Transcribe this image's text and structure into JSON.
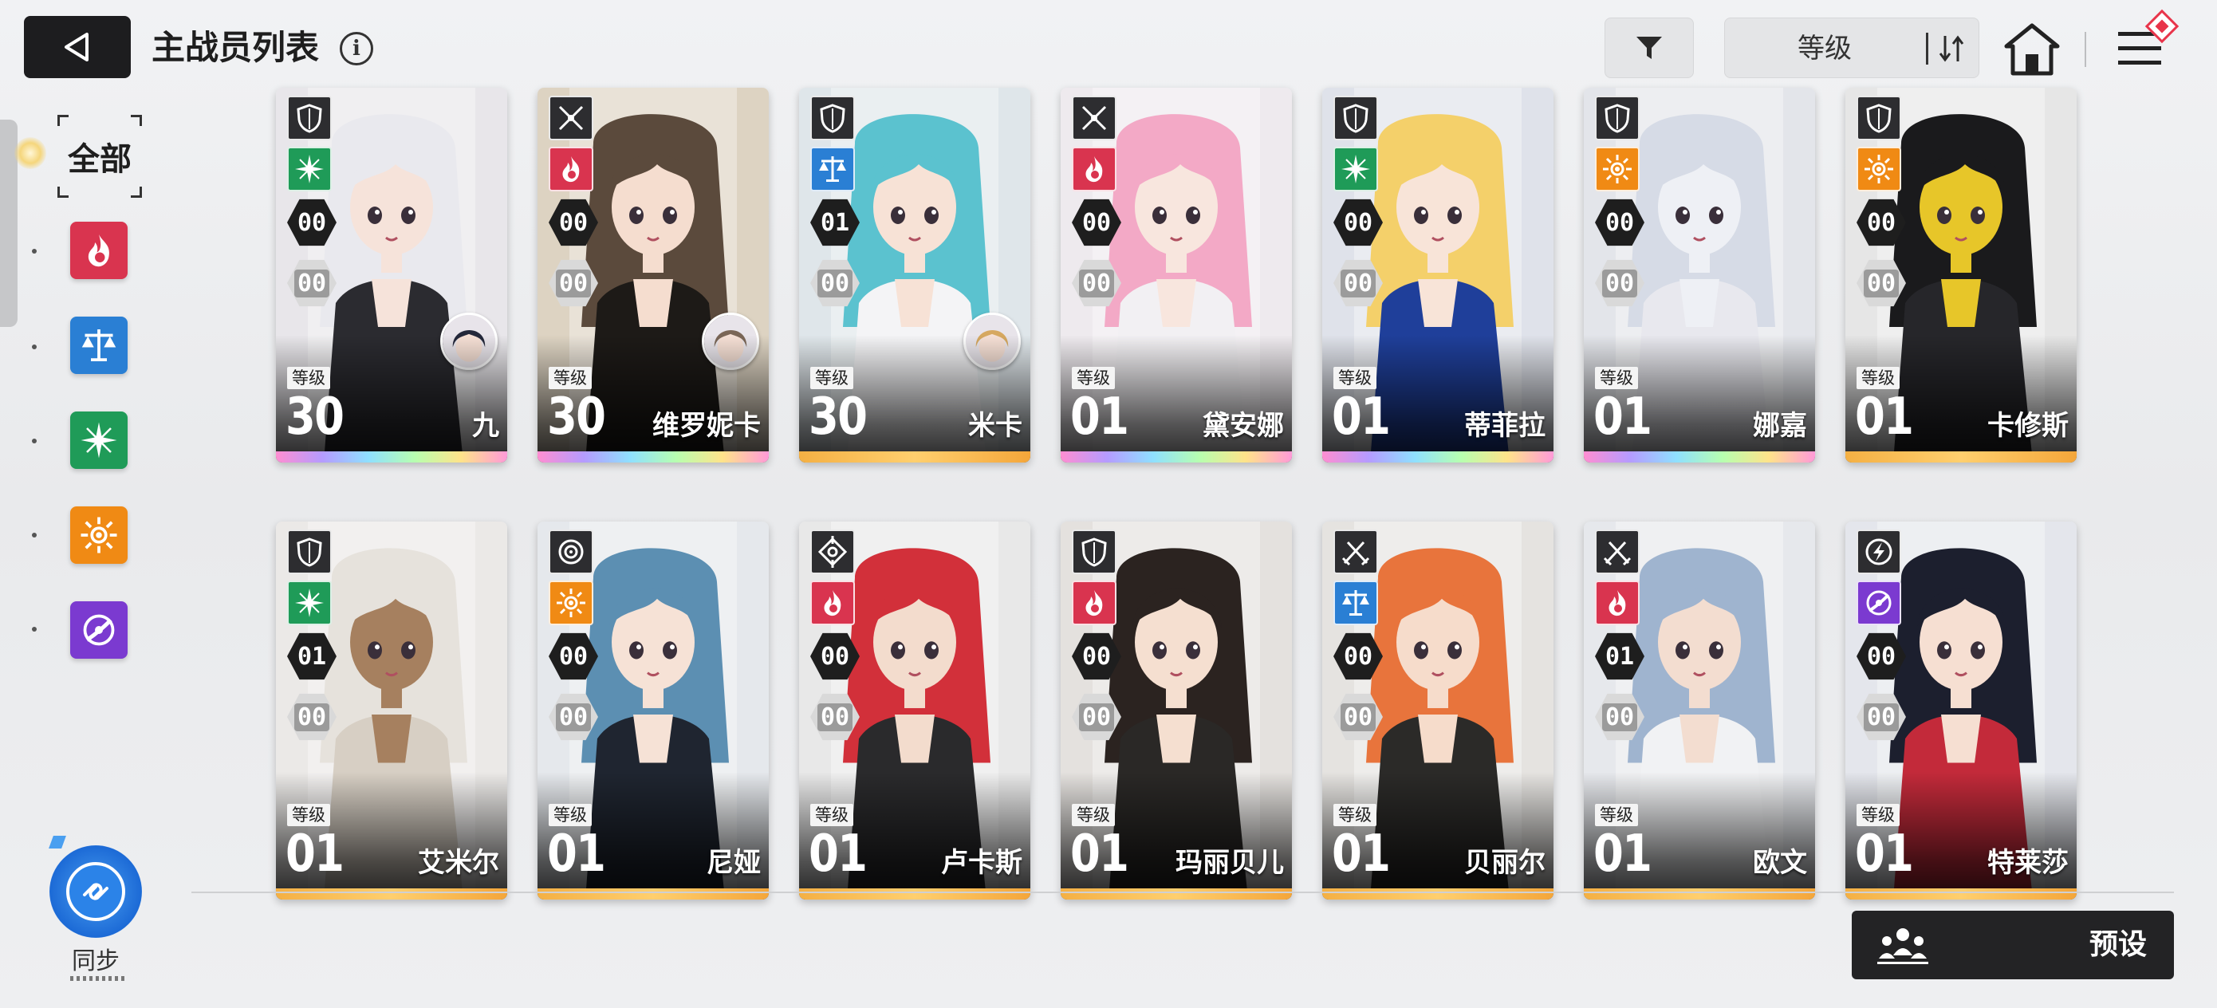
{
  "header": {
    "title": "主战员列表",
    "info_label": "i",
    "sort": {
      "label": "等级"
    }
  },
  "sidebar": {
    "all_label": "全部",
    "filters": [
      {
        "name": "fire",
        "color": "#d9344f"
      },
      {
        "name": "balance",
        "color": "#2a7fd4"
      },
      {
        "name": "wind",
        "color": "#1f9b58"
      },
      {
        "name": "solar",
        "color": "#f08a14"
      },
      {
        "name": "void",
        "color": "#7b3ad0"
      }
    ],
    "sync_label": "同步"
  },
  "level_tag": "等级",
  "cards": [
    {
      "name": "九",
      "level": "30",
      "stat1": "00",
      "stat2": "00",
      "class_icon": "shield-icon",
      "element": "wind",
      "element_color": "#1f9b58",
      "rarity": "rainbow",
      "hair": "#e9e9ee",
      "outfit": "#2b2b30",
      "skin": "#f6e3da",
      "bg": "#e8e6ea",
      "has_avatar": true,
      "avatar_hair": "#24283a"
    },
    {
      "name": "维罗妮卡",
      "level": "30",
      "stat1": "00",
      "stat2": "00",
      "class_icon": "sword-icon",
      "element": "fire",
      "element_color": "#d9344f",
      "rarity": "rainbow",
      "hair": "#5b4a3c",
      "outfit": "#1d1a17",
      "skin": "#f5ddcf",
      "bg": "#ddd3c2",
      "has_avatar": true,
      "avatar_hair": "#7a6656"
    },
    {
      "name": "米卡",
      "level": "30",
      "stat1": "01",
      "stat2": "00",
      "class_icon": "shield-icon",
      "element": "balance",
      "element_color": "#2a7fd4",
      "rarity": "gold",
      "hair": "#5bc2cf",
      "outfit": "#f4f4f6",
      "skin": "#f7e2d6",
      "bg": "#dfe6ea",
      "has_avatar": true,
      "avatar_hair": "#d6a860"
    },
    {
      "name": "黛安娜",
      "level": "01",
      "stat1": "00",
      "stat2": "00",
      "class_icon": "sword-icon",
      "element": "fire",
      "element_color": "#d9344f",
      "rarity": "rainbow",
      "hair": "#f3a9c6",
      "outfit": "#f2f0f3",
      "skin": "#f8e6de",
      "bg": "#eeeaee",
      "has_avatar": false,
      "avatar_hair": ""
    },
    {
      "name": "蒂菲拉",
      "level": "01",
      "stat1": "00",
      "stat2": "00",
      "class_icon": "shield-icon",
      "element": "wind",
      "element_color": "#1f9b58",
      "rarity": "rainbow",
      "hair": "#f4d06a",
      "outfit": "#1f3f9a",
      "skin": "#f8e4d8",
      "bg": "#dfe2ea",
      "has_avatar": false,
      "avatar_hair": ""
    },
    {
      "name": "娜嘉",
      "level": "01",
      "stat1": "00",
      "stat2": "00",
      "class_icon": "shield-icon",
      "element": "solar",
      "element_color": "#f08a14",
      "rarity": "rainbow",
      "hair": "#d6dbe6",
      "outfit": "#e8e8ee",
      "skin": "#eef0f5",
      "bg": "#e3e5ea",
      "has_avatar": false,
      "avatar_hair": ""
    },
    {
      "name": "卡修斯",
      "level": "01",
      "stat1": "00",
      "stat2": "00",
      "class_icon": "shield-icon",
      "element": "solar",
      "element_color": "#f08a14",
      "rarity": "gold",
      "hair": "#1a1a1c",
      "outfit": "#26262a",
      "skin": "#e7c629",
      "bg": "#e6e6e6",
      "has_avatar": false,
      "avatar_hair": ""
    },
    {
      "name": "艾米尔",
      "level": "01",
      "stat1": "01",
      "stat2": "00",
      "class_icon": "shield-icon",
      "element": "wind",
      "element_color": "#1f9b58",
      "rarity": "gold",
      "hair": "#e6e2dc",
      "outfit": "#d7cfc4",
      "skin": "#a6805f",
      "bg": "#ebe9e7",
      "has_avatar": false,
      "avatar_hair": ""
    },
    {
      "name": "尼娅",
      "level": "01",
      "stat1": "00",
      "stat2": "00",
      "class_icon": "target-icon",
      "element": "solar",
      "element_color": "#f08a14",
      "rarity": "gold",
      "hair": "#5c8fb2",
      "outfit": "#1f2530",
      "skin": "#f6e2d6",
      "bg": "#e5e8ec",
      "has_avatar": false,
      "avatar_hair": ""
    },
    {
      "name": "卢卡斯",
      "level": "01",
      "stat1": "00",
      "stat2": "00",
      "class_icon": "crosshair-icon",
      "element": "fire",
      "element_color": "#d9344f",
      "rarity": "gold",
      "hair": "#d2303a",
      "outfit": "#2a2a2c",
      "skin": "#f3dccd",
      "bg": "#e8e8e8",
      "has_avatar": false,
      "avatar_hair": ""
    },
    {
      "name": "玛丽贝儿",
      "level": "01",
      "stat1": "00",
      "stat2": "00",
      "class_icon": "shield-icon",
      "element": "fire",
      "element_color": "#d9344f",
      "rarity": "gold",
      "hair": "#2b2320",
      "outfit": "#2a2826",
      "skin": "#f5dfd0",
      "bg": "#e4e1de",
      "has_avatar": false,
      "avatar_hair": ""
    },
    {
      "name": "贝丽尔",
      "level": "01",
      "stat1": "00",
      "stat2": "00",
      "class_icon": "dual-sword-icon",
      "element": "balance",
      "element_color": "#2a7fd4",
      "rarity": "gold",
      "hair": "#e8743c",
      "outfit": "#2b2a28",
      "skin": "#f6dccb",
      "bg": "#e5e3e0",
      "has_avatar": false,
      "avatar_hair": ""
    },
    {
      "name": "欧文",
      "level": "01",
      "stat1": "01",
      "stat2": "00",
      "class_icon": "dual-sword-icon",
      "element": "fire",
      "element_color": "#d9344f",
      "rarity": "gold",
      "hair": "#9fb4cf",
      "outfit": "#f1f2f4",
      "skin": "#f3ddd0",
      "bg": "#e6e8ec",
      "has_avatar": false,
      "avatar_hair": ""
    },
    {
      "name": "特莱莎",
      "level": "01",
      "stat1": "00",
      "stat2": "00",
      "class_icon": "lightning-icon",
      "element": "void",
      "element_color": "#7b3ad0",
      "rarity": "gold",
      "hair": "#1c1f2e",
      "outfit": "#c32a3a",
      "skin": "#f6dfd2",
      "bg": "#e4e6ec",
      "has_avatar": false,
      "avatar_hair": ""
    }
  ],
  "footer": {
    "preset_label": "预设"
  }
}
